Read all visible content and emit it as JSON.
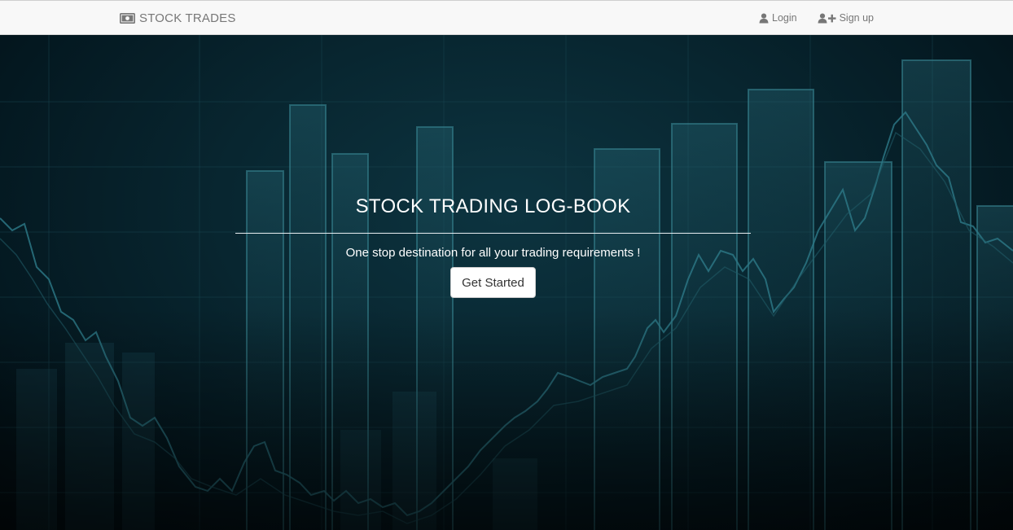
{
  "navbar": {
    "brand": "STOCK TRADES",
    "brand_icon": "money-icon",
    "login_label": "Login",
    "login_icon": "user-icon",
    "signup_label": "Sign up",
    "signup_icon": "user-plus-icon"
  },
  "hero": {
    "title": "STOCK TRADING LOG-BOOK",
    "subtitle": "One stop destination for all your trading requirements !",
    "cta_label": "Get Started"
  },
  "colors": {
    "navbar_bg": "#f8f8f8",
    "nav_text": "#777777",
    "hero_bg": "#082630",
    "hero_text": "#ffffff",
    "chart_line": "#1f5a66"
  }
}
